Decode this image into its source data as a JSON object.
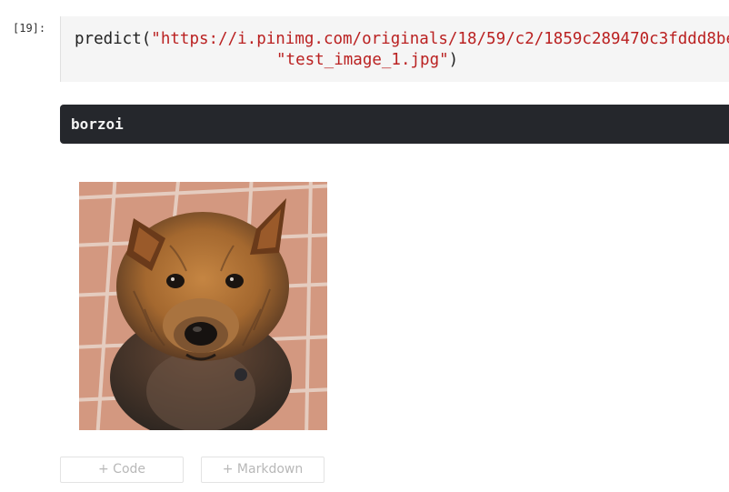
{
  "cell": {
    "prompt": "[19]:",
    "code_func": "predict(",
    "code_url": "\"https://i.pinimg.com/originals/18/59/c2/1859c289470c3fddd8be",
    "code_filename": "\"test_image_1.jpg\"",
    "code_close": ")"
  },
  "output": {
    "text": "borzoi",
    "image_icon": "dog-photo"
  },
  "toolbar": {
    "add_code_label": "+ Code",
    "add_markdown_label": "+ Markdown"
  },
  "colors": {
    "code_bg": "#f5f5f5",
    "string": "#ba2121",
    "output_bg": "#25272c",
    "output_text": "#f4f4f4"
  }
}
